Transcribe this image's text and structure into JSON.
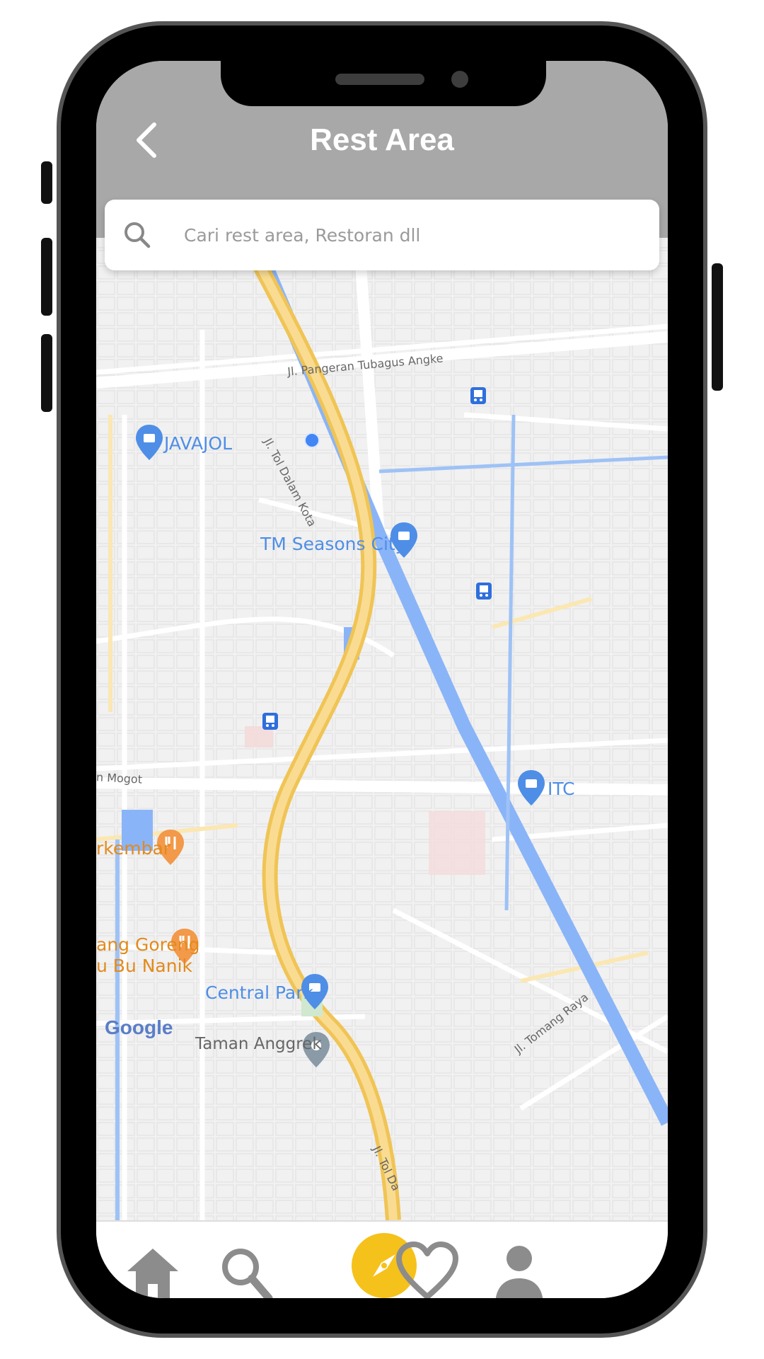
{
  "header": {
    "title": "Rest Area"
  },
  "search": {
    "placeholder": "Cari rest area, Restoran dll"
  },
  "map": {
    "pois": [
      {
        "label": "JAVAJOL",
        "type": "shopping"
      },
      {
        "label": "TM Seasons City",
        "type": "shopping"
      },
      {
        "label": "ITC",
        "type": "shopping"
      },
      {
        "label": "rkembar",
        "type": "restaurant"
      },
      {
        "label": "ang Goreng",
        "type": "restaurant"
      },
      {
        "label": "u Bu Nanik",
        "type": "restaurant"
      },
      {
        "label": "Central Park",
        "type": "shopping"
      },
      {
        "label": "Taman Anggrek",
        "type": "place"
      }
    ],
    "roads": [
      "Jl. Pangeran Tubagus Angke",
      "Jl. Tol Dalam Kota",
      "n Mogot",
      "Jl. Tomang Raya",
      "Jl. Tol Da"
    ],
    "attribution": "Google"
  },
  "nav": {
    "items": [
      {
        "name": "home",
        "icon": "home-icon"
      },
      {
        "name": "search",
        "icon": "search-icon"
      },
      {
        "name": "explore",
        "icon": "compass-icon"
      },
      {
        "name": "favorites",
        "icon": "heart-icon"
      },
      {
        "name": "profile",
        "icon": "user-icon"
      }
    ],
    "active_color": "#f5c11b"
  },
  "colors": {
    "header_bg": "#a8a8a8",
    "highway": "#f7d27a",
    "river": "#8ab4f8"
  }
}
